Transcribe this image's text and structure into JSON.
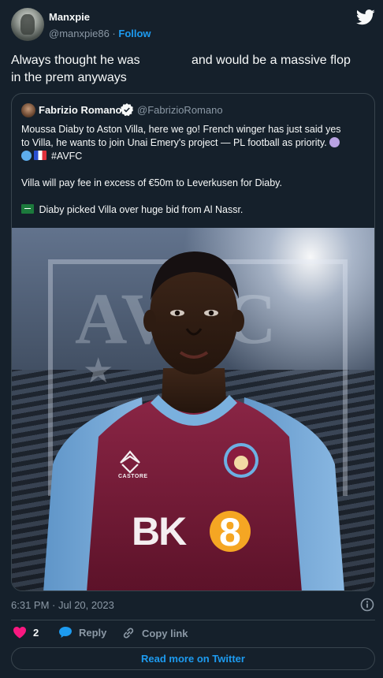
{
  "author": {
    "name": "Manxpie",
    "handle": "@manxpie86",
    "separator": "·",
    "follow_label": "Follow"
  },
  "tweet": {
    "line1a": "Always thought he was",
    "line1b": "and would be a massive flop",
    "line2": "in the prem anyways"
  },
  "quoted": {
    "name": "Fabrizio Romano",
    "handle": "@FabrizioRomano",
    "lines": [
      "Moussa Diaby to Aston Villa, here we go! French winger has just said yes",
      "to Villa, he wants to join Unai Emery's project — PL football as priority.",
      "#AVFC",
      "",
      "Villa will pay fee in excess of €50m to Leverkusen for Diaby.",
      "",
      "Diaby picked Villa over huge bid from Al Nassr."
    ],
    "image": {
      "background_text": "AVFC",
      "kit_sponsor": "BK8",
      "kit_maker": "CASTORE",
      "badge_text": "ASTON VILLA"
    }
  },
  "meta": {
    "timestamp": "6:31 PM · Jul 20, 2023"
  },
  "actions": {
    "likes_count": "2",
    "reply_label": "Reply",
    "copy_link_label": "Copy link"
  },
  "read_more_label": "Read more on Twitter",
  "colors": {
    "background": "#15202b",
    "text": "#f7f9f9",
    "muted": "#8b98a5",
    "accent": "#1d9bf0",
    "like": "#f91880",
    "border": "#38444d",
    "claret": "#7a1f3d",
    "sky_blue": "#6aa6d8"
  },
  "icons": [
    "twitter-bird-icon",
    "verified-badge-icon",
    "heart-icon",
    "reply-bubble-icon",
    "link-icon",
    "info-icon"
  ]
}
